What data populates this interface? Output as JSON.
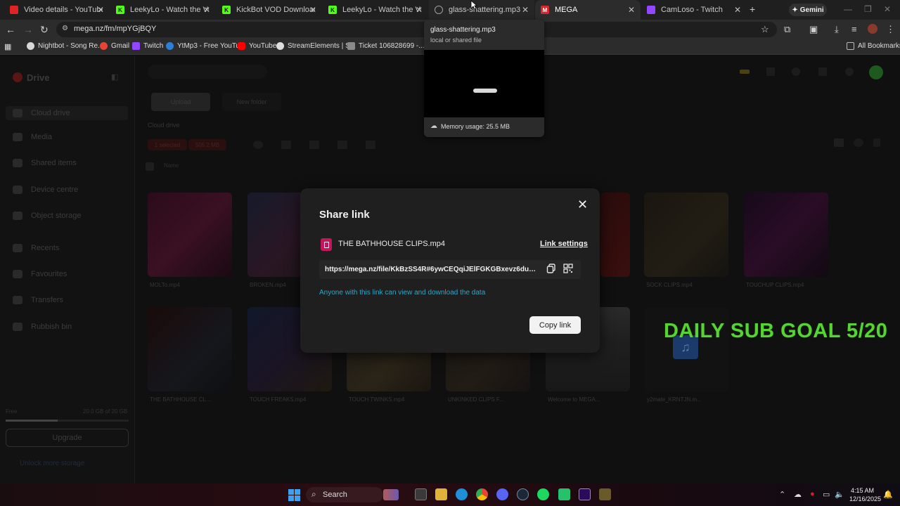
{
  "browser": {
    "tabs": [
      {
        "title": "Video details - YouTube Studio",
        "favicon_color": "#e02424",
        "active": false
      },
      {
        "title": "LeekyLo - Watch the VOD on",
        "favicon_color": "#53fc18",
        "active": false
      },
      {
        "title": "KickBot VOD Downloader",
        "favicon_color": "#53fc18",
        "active": false
      },
      {
        "title": "LeekyLo - Watch the VOD on",
        "favicon_color": "#53fc18",
        "active": false
      },
      {
        "title": "glass-shattering.mp3",
        "favicon_color": "#9aa0a6",
        "active": false
      },
      {
        "title": "MEGA",
        "favicon_color": "#d9272e",
        "active": true
      },
      {
        "title": "CamLoso - Twitch",
        "favicon_color": "#9146ff",
        "active": false
      }
    ],
    "new_tab_label": "+",
    "gemini_label": "Gemini",
    "url": "mega.nz/fm/mpYGjBQY",
    "bookmarks": [
      {
        "label": "Nightbot - Song Re...",
        "color": "#d8d8d8"
      },
      {
        "label": "Gmail",
        "color": "#ea4335"
      },
      {
        "label": "Twitch",
        "color": "#9146ff"
      },
      {
        "label": "YtMp3 - Free YouTu...",
        "color": "#2b7fd8"
      },
      {
        "label": "YouTube",
        "color": "#ff0000"
      },
      {
        "label": "StreamElements | S...",
        "color": "#dddddd"
      },
      {
        "label": "Ticket 106828699 -...",
        "color": "#8a8a8a"
      }
    ],
    "all_bookmarks_label": "All Bookmarks"
  },
  "hover_card": {
    "title": "glass-shattering.mp3",
    "subtitle": "local or shared file",
    "memory": "Memory usage: 25.5 MB"
  },
  "mega": {
    "sidebar": {
      "logo": "Drive",
      "items": [
        "Cloud drive",
        "Media",
        "Shared items",
        "Device centre",
        "Object storage",
        "Recents",
        "Favourites",
        "Transfers",
        "Rubbish bin"
      ],
      "storage_left": "Free",
      "storage_right": "20.0 GB of 20 GB",
      "storage_fraction": 0.42,
      "upgrade_label": "Upgrade",
      "unlock_label": "Unlock more storage"
    },
    "toolbar": {
      "upload_label": "Upload",
      "new_folder_label": "New folder",
      "section_title": "Cloud drive",
      "selected_badge": "1 selected",
      "selected_size": "505.2 MB",
      "sort_label": "Name"
    },
    "files": [
      {
        "name": "MOLTo.mp4",
        "row": 0
      },
      {
        "name": "BROKEN.mp4",
        "row": 0
      },
      {
        "name": "SOCK CLIPS.mp4",
        "row": 0
      },
      {
        "name": "TOUCHUP CLIPS.mp4",
        "row": 0
      },
      {
        "name": "THE BATHHOUSE CL...",
        "row": 1
      },
      {
        "name": "TOUCH FREAKS.mp4",
        "row": 1
      },
      {
        "name": "TOUCH TWINKS.mp4",
        "row": 1
      },
      {
        "name": "UNKINKED CLIPS F...",
        "row": 1
      },
      {
        "name": "Welcome to MEGA...",
        "row": 1
      },
      {
        "name": "y2mate_KRNTJN.m...",
        "row": 1
      }
    ]
  },
  "share_dialog": {
    "title": "Share link",
    "file_name": "THE BATHHOUSE CLIPS.mp4",
    "link_settings_label": "Link settings",
    "link": "https://mega.nz/file/KkBzSS4R#6ywCEQqiJElFGKGBxevz6dunNxnt...",
    "notice": "Anyone with this link can view and download the data",
    "copy_button_label": "Copy link",
    "accent_color": "#30a6c8"
  },
  "stream_overlay": {
    "text": "DAILY SUB GOAL 5/20",
    "color": "#58d334"
  },
  "taskbar": {
    "search_label": "Search",
    "time": "4:15 AM",
    "date": "12/16/2025"
  }
}
